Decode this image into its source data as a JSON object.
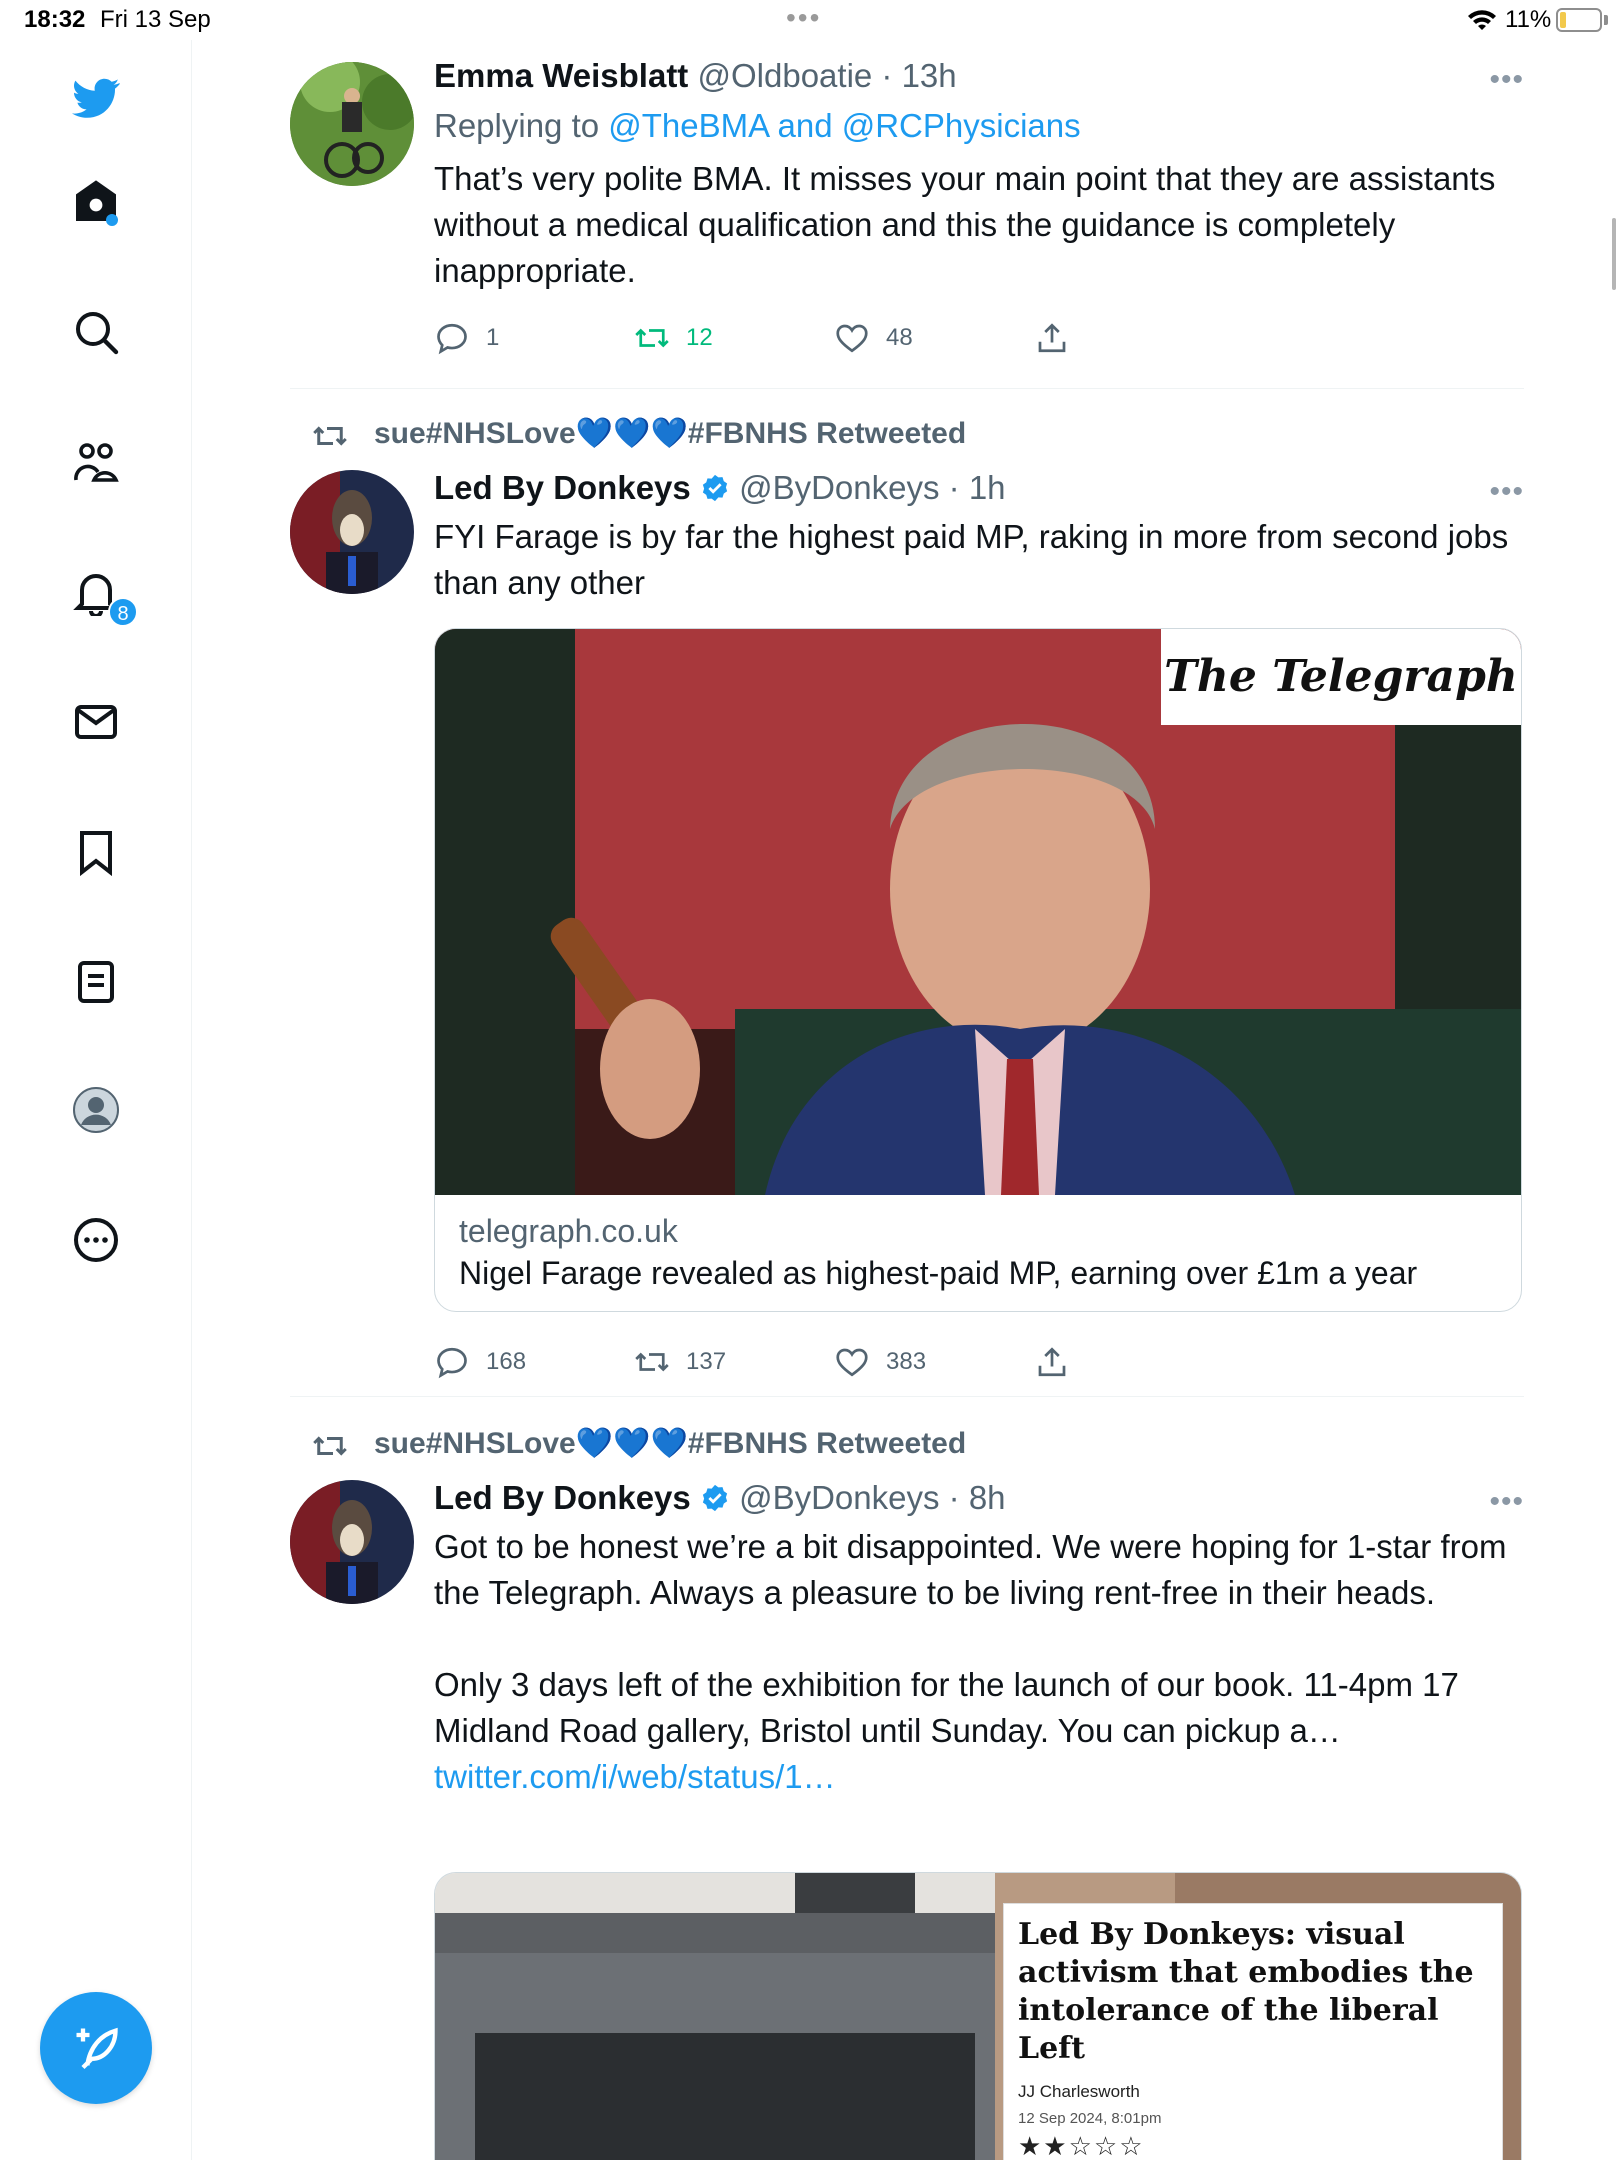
{
  "status_bar": {
    "time": "18:32",
    "date": "Fri 13 Sep",
    "battery": "11%"
  },
  "sidebar": {
    "notification_count": "8",
    "items": [
      "home",
      "explore",
      "communities",
      "notifications",
      "messages",
      "bookmarks",
      "lists",
      "profile",
      "more"
    ]
  },
  "tweets": [
    {
      "name": "Emma Weisblatt",
      "handle": "@Oldboatie",
      "time": "· 13h",
      "replying_prefix": "Replying to ",
      "replying_targets": "@TheBMA and @RCPhysicians",
      "text": "That’s very polite BMA. It misses your main point that they are assistants without a medical qualification and this the guidance is completely inappropriate.",
      "replies": "1",
      "retweets": "12",
      "likes": "48"
    },
    {
      "retweeted_by": "sue#NHSLove💙💙💙#FBNHS Retweeted",
      "name": "Led By Donkeys",
      "handle": "@ByDonkeys",
      "time": "· 1h",
      "text": "FYI Farage is by far the highest paid MP, raking in more from second jobs than any other",
      "card": {
        "logo": "The Telegraph",
        "domain": "telegraph.co.uk",
        "title": "Nigel Farage revealed as highest-paid MP, earning over £1m a year"
      },
      "replies": "168",
      "retweets": "137",
      "likes": "383"
    },
    {
      "retweeted_by": "sue#NHSLove💙💙💙#FBNHS Retweeted",
      "name": "Led By Donkeys",
      "handle": "@ByDonkeys",
      "time": "· 8h",
      "text": "Got to be honest we’re a bit disappointed. We were hoping for 1-star from the Telegraph. Always a pleasure to be living rent-free in their heads.\n\nOnly 3 days left of the exhibition for the launch of our book. 11-4pm 17 Midland Road gallery, Bristol until Sunday. You can pickup a…",
      "link": "twitter.com/i/web/status/1…",
      "media": {
        "headline": "Led By Donkeys: visual activism that embodies the intolerance of the liberal Left",
        "author": "JJ Charlesworth",
        "date": "12 Sep 2024, 8:01pm",
        "stars": "★★☆☆☆"
      }
    }
  ]
}
